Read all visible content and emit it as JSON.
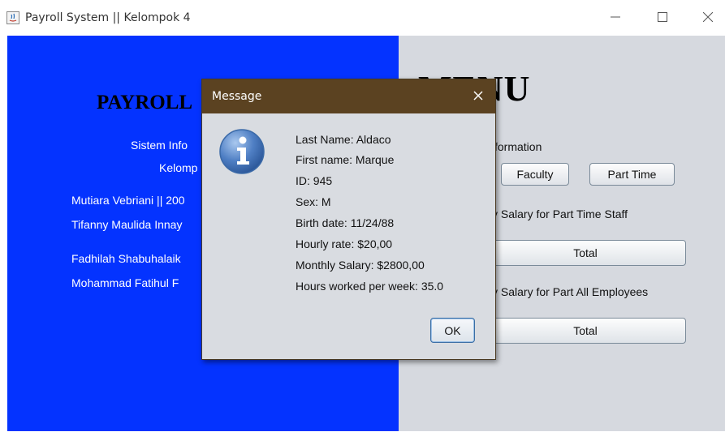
{
  "window": {
    "title": "Payroll System || Kelompok 4"
  },
  "left_panel": {
    "title": "PAYROLL",
    "subtitle1": "Sistem Info",
    "subtitle2": "Kelomp",
    "members": [
      "Mutiara Vebriani || 200",
      "Tifanny Maulida Innay",
      "Fadhilah Shabuhalaik",
      "Mohammad Fatihul F"
    ]
  },
  "right_panel": {
    "title": "MENU",
    "section_info": "formation",
    "faculty_button": "Faculty",
    "part_time_button": "Part Time",
    "salary_part_time_label": "y Salary for Part Time Staff",
    "total_button_1": "Total",
    "salary_all_label": "y Salary for Part All Employees",
    "total_button_2": "Total"
  },
  "dialog": {
    "title": "Message",
    "lines": [
      "Last Name: Aldaco",
      "First name: Marque",
      "ID: 945",
      "Sex: M",
      "Birth date: 11/24/88",
      "Hourly rate: $20,00",
      "Monthly Salary: $2800,00",
      "Hours worked per week: 35.0"
    ],
    "ok_label": "OK"
  },
  "colors": {
    "left_panel_bg": "#0433ff",
    "right_panel_bg": "#d6d9df",
    "dialog_titlebar": "#5b4221"
  }
}
